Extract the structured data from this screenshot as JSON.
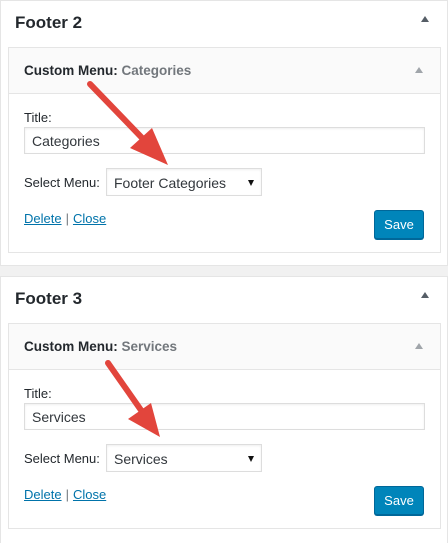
{
  "areas": [
    {
      "title": "Footer 2",
      "widget": {
        "name": "Custom Menu:",
        "subtitle": "Categories",
        "title_label": "Title:",
        "title_value": "Categories",
        "select_label": "Select Menu:",
        "select_value": "Footer Categories",
        "delete_label": "Delete",
        "separator": "|",
        "close_label": "Close",
        "save_label": "Save"
      }
    },
    {
      "title": "Footer 3",
      "widget": {
        "name": "Custom Menu:",
        "subtitle": "Services",
        "title_label": "Title:",
        "title_value": "Services",
        "select_label": "Select Menu:",
        "select_value": "Services",
        "delete_label": "Delete",
        "separator": "|",
        "close_label": "Close",
        "save_label": "Save"
      }
    }
  ],
  "colors": {
    "primary_button": "#0085ba",
    "link": "#0073aa",
    "annotation_arrow": "#e2453c"
  },
  "icons": [
    "collapse-arrow-icon",
    "annotation-arrow-icon",
    "select-caret-icon"
  ]
}
